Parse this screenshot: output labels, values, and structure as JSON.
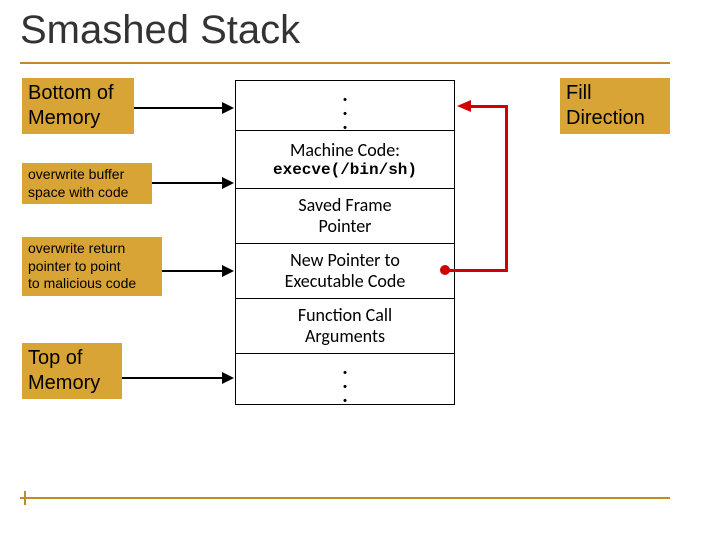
{
  "title": "Smashed Stack",
  "labels": {
    "bottom_of_memory": "Bottom of\nMemory",
    "overwrite_buffer": "overwrite buffer\nspace with code",
    "overwrite_return": "overwrite return\npointer to point\nto malicious code",
    "top_of_memory": "Top of\nMemory",
    "fill_direction": "Fill\nDirection"
  },
  "stack": {
    "cells": [
      {
        "kind": "dots"
      },
      {
        "line1": "Machine Code:",
        "line2": "execve(/bin/sh)"
      },
      {
        "line1": "Saved Frame",
        "line2": "Pointer"
      },
      {
        "line1": "New Pointer to",
        "line2": "Executable Code"
      },
      {
        "line1": "Function Call",
        "line2": "Arguments"
      },
      {
        "kind": "dots"
      }
    ]
  },
  "icons": {
    "dot": "."
  }
}
